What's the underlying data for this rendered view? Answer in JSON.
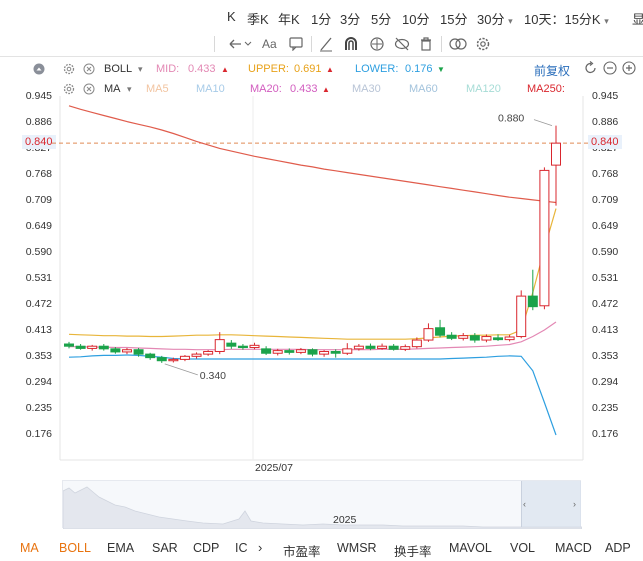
{
  "topbar": {
    "periods": [
      "K",
      "季K",
      "年K",
      "1分",
      "3分",
      "5分",
      "10分",
      "15分",
      "30分",
      "10天：15分K",
      "显"
    ]
  },
  "legend": {
    "boll": {
      "name": "BOLL",
      "mid_label": "MID:",
      "mid_value": "0.433",
      "upper_label": "UPPER:",
      "upper_value": "0.691",
      "lower_label": "LOWER:",
      "lower_value": "0.176"
    },
    "ma": {
      "name": "MA",
      "ma5": "MA5",
      "ma10": "MA10",
      "ma20_label": "MA20:",
      "ma20_value": "0.433",
      "ma30": "MA30",
      "ma60": "MA60",
      "ma120": "MA120",
      "ma250_label": "MA250:"
    },
    "adjust_label": "前复权"
  },
  "chart_data": {
    "type": "candlestick",
    "y_ticks": [
      "0.945",
      "0.886",
      "0.827",
      "0.768",
      "0.709",
      "0.649",
      "0.590",
      "0.531",
      "0.472",
      "0.413",
      "0.353",
      "0.294",
      "0.235",
      "0.176"
    ],
    "ylim": [
      0.15,
      0.975
    ],
    "x_label": "2025/07",
    "current_price": "0.840",
    "annotations": {
      "high": "0.880",
      "low": "0.340"
    },
    "candles": [
      [
        0.383,
        0.378,
        0.388,
        0.373
      ],
      [
        0.378,
        0.373,
        0.383,
        0.37
      ],
      [
        0.373,
        0.378,
        0.381,
        0.368
      ],
      [
        0.378,
        0.372,
        0.383,
        0.368
      ],
      [
        0.372,
        0.365,
        0.376,
        0.361
      ],
      [
        0.365,
        0.37,
        0.374,
        0.36
      ],
      [
        0.37,
        0.36,
        0.374,
        0.354
      ],
      [
        0.36,
        0.352,
        0.363,
        0.347
      ],
      [
        0.352,
        0.345,
        0.356,
        0.34
      ],
      [
        0.345,
        0.348,
        0.352,
        0.341
      ],
      [
        0.348,
        0.355,
        0.358,
        0.344
      ],
      [
        0.355,
        0.36,
        0.364,
        0.35
      ],
      [
        0.36,
        0.366,
        0.369,
        0.356
      ],
      [
        0.366,
        0.393,
        0.41,
        0.36
      ],
      [
        0.385,
        0.378,
        0.392,
        0.372
      ],
      [
        0.378,
        0.375,
        0.383,
        0.37
      ],
      [
        0.375,
        0.38,
        0.386,
        0.371
      ],
      [
        0.372,
        0.362,
        0.378,
        0.358
      ],
      [
        0.362,
        0.368,
        0.372,
        0.357
      ],
      [
        0.368,
        0.364,
        0.373,
        0.359
      ],
      [
        0.364,
        0.37,
        0.374,
        0.36
      ],
      [
        0.37,
        0.36,
        0.373,
        0.355
      ],
      [
        0.36,
        0.366,
        0.369,
        0.354
      ],
      [
        0.366,
        0.362,
        0.371,
        0.352
      ],
      [
        0.362,
        0.372,
        0.385,
        0.358
      ],
      [
        0.372,
        0.378,
        0.383,
        0.368
      ],
      [
        0.378,
        0.373,
        0.384,
        0.369
      ],
      [
        0.373,
        0.378,
        0.384,
        0.37
      ],
      [
        0.378,
        0.371,
        0.383,
        0.368
      ],
      [
        0.371,
        0.377,
        0.382,
        0.367
      ],
      [
        0.377,
        0.392,
        0.398,
        0.373
      ],
      [
        0.392,
        0.418,
        0.43,
        0.388
      ],
      [
        0.42,
        0.403,
        0.438,
        0.398
      ],
      [
        0.403,
        0.396,
        0.41,
        0.392
      ],
      [
        0.396,
        0.402,
        0.408,
        0.391
      ],
      [
        0.402,
        0.392,
        0.408,
        0.386
      ],
      [
        0.392,
        0.4,
        0.405,
        0.387
      ],
      [
        0.397,
        0.393,
        0.405,
        0.39
      ],
      [
        0.393,
        0.399,
        0.404,
        0.389
      ],
      [
        0.4,
        0.492,
        0.505,
        0.396
      ],
      [
        0.492,
        0.468,
        0.552,
        0.46
      ],
      [
        0.47,
        0.778,
        0.785,
        0.462
      ],
      [
        0.79,
        0.84,
        0.88,
        0.698
      ]
    ],
    "series": [
      {
        "name": "UPPER",
        "color": "#e8b53a",
        "values": [
          0.405,
          0.404,
          0.403,
          0.402,
          0.402,
          0.401,
          0.401,
          0.4,
          0.4,
          0.401,
          0.402,
          0.403,
          0.403,
          0.404,
          0.404,
          0.403,
          0.402,
          0.401,
          0.4,
          0.399,
          0.398,
          0.397,
          0.396,
          0.395,
          0.394,
          0.394,
          0.394,
          0.394,
          0.394,
          0.394,
          0.395,
          0.397,
          0.399,
          0.401,
          0.402,
          0.403,
          0.403,
          0.404,
          0.404,
          0.415,
          0.5,
          0.6,
          0.691
        ]
      },
      {
        "name": "MID",
        "color": "#e388b4",
        "values": [
          0.377,
          0.377,
          0.376,
          0.376,
          0.375,
          0.375,
          0.374,
          0.373,
          0.372,
          0.371,
          0.371,
          0.37,
          0.37,
          0.37,
          0.371,
          0.371,
          0.371,
          0.371,
          0.371,
          0.371,
          0.371,
          0.37,
          0.37,
          0.37,
          0.37,
          0.37,
          0.37,
          0.371,
          0.371,
          0.371,
          0.372,
          0.373,
          0.374,
          0.375,
          0.376,
          0.377,
          0.378,
          0.38,
          0.382,
          0.388,
          0.4,
          0.415,
          0.433
        ]
      },
      {
        "name": "LOWER",
        "color": "#2e9fe0",
        "values": [
          0.353,
          0.354,
          0.356,
          0.357,
          0.357,
          0.358,
          0.357,
          0.355,
          0.353,
          0.35,
          0.349,
          0.349,
          0.349,
          0.349,
          0.349,
          0.349,
          0.349,
          0.349,
          0.349,
          0.349,
          0.349,
          0.349,
          0.349,
          0.349,
          0.349,
          0.349,
          0.349,
          0.349,
          0.349,
          0.349,
          0.349,
          0.349,
          0.349,
          0.35,
          0.351,
          0.352,
          0.353,
          0.355,
          0.356,
          0.355,
          0.322,
          0.25,
          0.176
        ]
      },
      {
        "name": "MA250",
        "color": "#e05c4c",
        "values": [
          0.925,
          0.917,
          0.91,
          0.903,
          0.896,
          0.889,
          0.883,
          0.877,
          0.87,
          0.862,
          0.853,
          0.844,
          0.836,
          0.828,
          0.822,
          0.816,
          0.81,
          0.805,
          0.8,
          0.795,
          0.79,
          0.786,
          0.781,
          0.777,
          0.773,
          0.769,
          0.765,
          0.761,
          0.757,
          0.753,
          0.749,
          0.745,
          0.741,
          0.737,
          0.733,
          0.729,
          0.725,
          0.721,
          0.717,
          0.714,
          0.711,
          0.708,
          0.705
        ]
      }
    ]
  },
  "navigator": {
    "year_label": "2025"
  },
  "bottom_indicators": [
    "MA",
    "BOLL",
    "EMA",
    "SAR",
    "CDP",
    "IC",
    "市盈率",
    "WMSR",
    "换手率",
    "MAVOL",
    "VOL",
    "MACD",
    "ADP"
  ],
  "colors": {
    "up": "#d9272e",
    "down": "#1aa34a",
    "accent": "#e8730f",
    "blue": "#2a6ebb"
  }
}
